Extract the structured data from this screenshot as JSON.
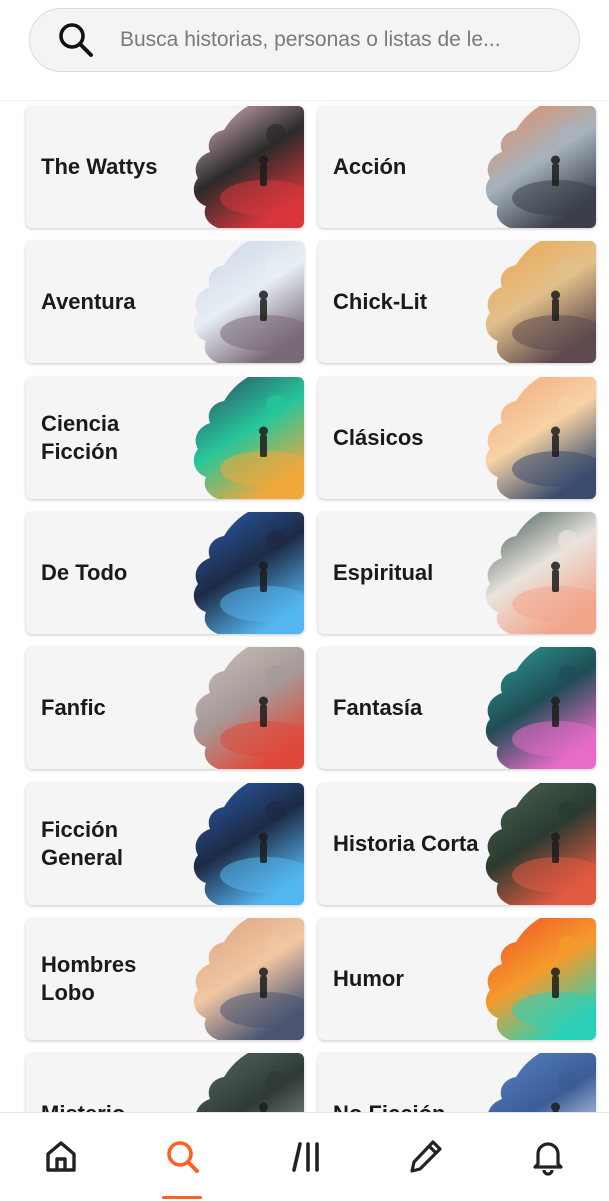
{
  "search": {
    "placeholder": "Busca historias, personas o listas de le..."
  },
  "categories": [
    {
      "label": "The Wattys",
      "colors": [
        "#f3c6d3",
        "#d8363b",
        "#2b2b2b"
      ]
    },
    {
      "label": "Acción",
      "colors": [
        "#e9895a",
        "#3a3f4a",
        "#a7b3bd"
      ]
    },
    {
      "label": "Aventura",
      "colors": [
        "#c7d3e0",
        "#7a6a78",
        "#e7eef5"
      ]
    },
    {
      "label": "Chick-Lit",
      "colors": [
        "#f0a24a",
        "#5e4a4f",
        "#e2c08a"
      ]
    },
    {
      "label": "Ciencia Ficción",
      "colors": [
        "#2d3f5e",
        "#f2a73b",
        "#27c69a"
      ]
    },
    {
      "label": "Clásicos",
      "colors": [
        "#f1a578",
        "#3b4d6e",
        "#f7d2a5"
      ]
    },
    {
      "label": "De Todo",
      "colors": [
        "#2a62b8",
        "#54b6f0",
        "#1d2a45"
      ]
    },
    {
      "label": "Espiritual",
      "colors": [
        "#2f4d48",
        "#f3a58c",
        "#e9e3dc"
      ]
    },
    {
      "label": "Fanfic",
      "colors": [
        "#cfc3bd",
        "#e0493a",
        "#a59a98"
      ]
    },
    {
      "label": "Fantasía",
      "colors": [
        "#2fa39a",
        "#e66cc7",
        "#1f4d55"
      ]
    },
    {
      "label": "Ficción General",
      "colors": [
        "#2a62b8",
        "#54b6f0",
        "#1d2a45"
      ]
    },
    {
      "label": "Historia Corta",
      "colors": [
        "#4f6a55",
        "#e15a42",
        "#2a3a30"
      ]
    },
    {
      "label": "Hombres Lobo",
      "colors": [
        "#d9a07a",
        "#4a5572",
        "#f1c6a3"
      ]
    },
    {
      "label": "Humor",
      "colors": [
        "#ef4a24",
        "#2bd0b8",
        "#f59b2c"
      ]
    },
    {
      "label": "Misterio",
      "colors": [
        "#5b6b66",
        "#8a9690",
        "#2f3a36"
      ]
    },
    {
      "label": "No Ficción",
      "colors": [
        "#5b86c9",
        "#dfe7f2",
        "#3a5d96"
      ]
    }
  ],
  "nav": {
    "items": [
      {
        "name": "home",
        "icon": "home-icon"
      },
      {
        "name": "search",
        "icon": "search-icon",
        "active": true
      },
      {
        "name": "library",
        "icon": "library-icon"
      },
      {
        "name": "write",
        "icon": "pencil-icon"
      },
      {
        "name": "notifications",
        "icon": "bell-icon"
      }
    ],
    "accent": "#ff6122",
    "icon_color": "#222222"
  }
}
